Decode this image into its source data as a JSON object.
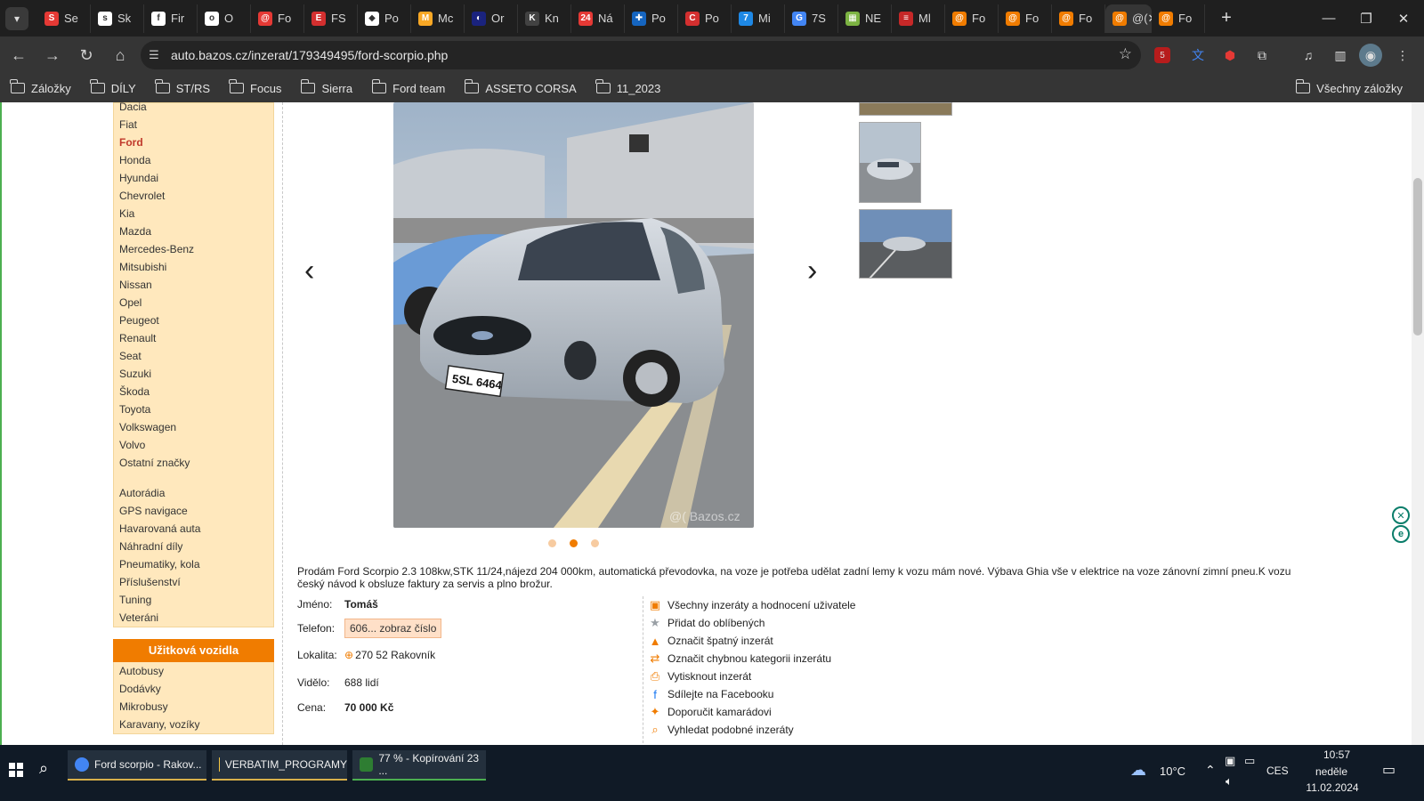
{
  "browser": {
    "tabs": [
      {
        "label": "Se",
        "color": "#e53935",
        "glyph": "S"
      },
      {
        "label": "Sk",
        "color": "#ffffff",
        "glyph": "s"
      },
      {
        "label": "Fir",
        "color": "#ffffff",
        "glyph": "f"
      },
      {
        "label": "O",
        "color": "#ffffff",
        "glyph": "o"
      },
      {
        "label": "Fo",
        "color": "#e53935",
        "glyph": "@"
      },
      {
        "label": "FS",
        "color": "#d32f2f",
        "glyph": "E"
      },
      {
        "label": "Po",
        "color": "#ffffff",
        "glyph": "◆"
      },
      {
        "label": "Mc",
        "color": "#f9a825",
        "glyph": "M"
      },
      {
        "label": "Or",
        "color": "#1a237e",
        "glyph": "◐"
      },
      {
        "label": "Kn",
        "color": "#424242",
        "glyph": "K"
      },
      {
        "label": "Ná",
        "color": "#e53935",
        "glyph": "24"
      },
      {
        "label": "Po",
        "color": "#1565c0",
        "glyph": "✚"
      },
      {
        "label": "Po",
        "color": "#d32f2f",
        "glyph": "C"
      },
      {
        "label": "Mi",
        "color": "#1e88e5",
        "glyph": "7"
      },
      {
        "label": "7S",
        "color": "#4285f4",
        "glyph": "G"
      },
      {
        "label": "NE",
        "color": "#7cb342",
        "glyph": "▦"
      },
      {
        "label": "Ml",
        "color": "#c62828",
        "glyph": "≡"
      },
      {
        "label": "Fo",
        "color": "#f07c00",
        "glyph": "@"
      },
      {
        "label": "Fo",
        "color": "#f07c00",
        "glyph": "@"
      },
      {
        "label": "Fo",
        "color": "#f07c00",
        "glyph": "@"
      },
      {
        "label": "@(",
        "color": "#f07c00",
        "glyph": "@",
        "active": true
      },
      {
        "label": "Fo",
        "color": "#f07c00",
        "glyph": "@"
      }
    ],
    "url": "auto.bazos.cz/inzerat/179349495/ford-scorpio.php",
    "bookmarks": [
      "Záložky",
      "DÍLY",
      "ST/RS",
      "Focus",
      "Sierra",
      "Ford team",
      "ASSETO CORSA",
      "11_2023"
    ],
    "all_bookmarks": "Všechny záložky",
    "ext_badge": "5"
  },
  "sidebar": {
    "brands": [
      "Dacia",
      "Fiat",
      "Ford",
      "Honda",
      "Hyundai",
      "Chevrolet",
      "Kia",
      "Mazda",
      "Mercedes-Benz",
      "Mitsubishi",
      "Nissan",
      "Opel",
      "Peugeot",
      "Renault",
      "Seat",
      "Suzuki",
      "Škoda",
      "Toyota",
      "Volkswagen",
      "Volvo",
      "Ostatní značky"
    ],
    "selected_brand": "Ford",
    "extras": [
      "Autorádia",
      "GPS navigace",
      "Havarovaná auta",
      "Náhradní díly",
      "Pneumatiky, kola",
      "Příslušenství",
      "Tuning",
      "Veteráni"
    ],
    "utility_head": "Užitková vozidla",
    "utility": [
      "Autobusy",
      "Dodávky",
      "Mikrobusy",
      "Karavany, vozíky"
    ]
  },
  "listing": {
    "plate": "5SL 6464",
    "watermark": "@( Bazos.cz",
    "description": "Prodám Ford Scorpio 2.3 108kw,STK 11/24,nájezd 204 000km, automatická převodovka, na voze je potřeba udělat zadní lemy k vozu mám nové. Výbava Ghia vše v elektrice na voze zánovní zimní pneu.K vozu český návod k obsluze faktury za servis a plno brožur.",
    "name_label": "Jméno:",
    "name": "Tomáš",
    "phone_label": "Telefon:",
    "phone_button": "606... zobraz číslo",
    "location_label": "Lokalita:",
    "location": "270 52 Rakovník",
    "views_label": "Vidělo:",
    "views": "688 lidí",
    "price_label": "Cena:",
    "price": "70 000 Kč",
    "links": [
      {
        "label": "Všechny inzeráty a hodnocení uživatele",
        "icon": "user-ads-icon"
      },
      {
        "label": "Přidat do oblíbených",
        "icon": "star-icon"
      },
      {
        "label": "Označit špatný inzerát",
        "icon": "warning-icon"
      },
      {
        "label": "Označit chybnou kategorii inzerátu",
        "icon": "swap-arrows-icon"
      },
      {
        "label": "Vytisknout inzerát",
        "icon": "printer-icon"
      },
      {
        "label": "Sdílejte na Facebooku",
        "icon": "facebook-icon"
      },
      {
        "label": "Doporučit kamarádovi",
        "icon": "recommend-icon"
      },
      {
        "label": "Vyhledat podobné inzeráty",
        "icon": "search-similar-icon"
      }
    ]
  },
  "taskbar": {
    "apps": [
      "Ford scorpio - Rakov...",
      "VERBATIM_PROGRAMY",
      "77 % - Kopírování 23 ..."
    ],
    "weather": "10°C",
    "lang": "CES",
    "time": "10:57",
    "day": "neděle",
    "date": "11.02.2024"
  }
}
